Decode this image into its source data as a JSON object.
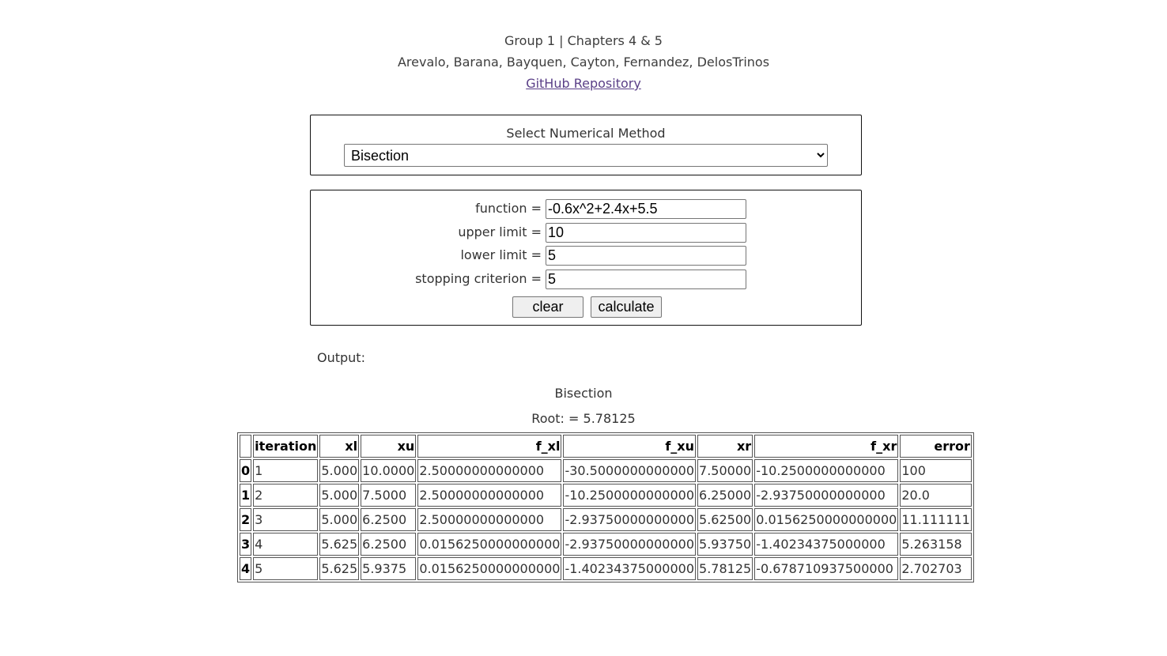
{
  "header": {
    "group_line": "Group 1 | Chapters 4 & 5",
    "authors": "Arevalo, Barana, Bayquen, Cayton, Fernandez, DelosTrinos",
    "repo_link": "GitHub Repository"
  },
  "method_panel": {
    "label": "Select Numerical Method",
    "selected": "Bisection"
  },
  "inputs": {
    "function_label": "function =",
    "function_value": "-0.6x^2+2.4x+5.5",
    "upper_label": "upper limit =",
    "upper_value": "10",
    "lower_label": "lower limit =",
    "lower_value": "5",
    "stop_label": "stopping criterion =",
    "stop_value": "5",
    "clear_label": "clear",
    "calculate_label": "calculate"
  },
  "output": {
    "label": "Output:",
    "method": "Bisection",
    "root": "Root: = 5.78125"
  },
  "table": {
    "headers": [
      "",
      "iteration",
      "xl",
      "xu",
      "f_xl",
      "f_xu",
      "xr",
      "f_xr",
      "error"
    ],
    "rows": [
      [
        "0",
        "1",
        "5.000",
        "10.0000",
        "2.50000000000000",
        "-30.5000000000000",
        "7.50000",
        "-10.2500000000000",
        "100"
      ],
      [
        "1",
        "2",
        "5.000",
        "7.5000",
        "2.50000000000000",
        "-10.2500000000000",
        "6.25000",
        "-2.93750000000000",
        "20.0"
      ],
      [
        "2",
        "3",
        "5.000",
        "6.2500",
        "2.50000000000000",
        "-2.93750000000000",
        "5.62500",
        "0.0156250000000000",
        "11.111111"
      ],
      [
        "3",
        "4",
        "5.625",
        "6.2500",
        "0.0156250000000000",
        "-2.93750000000000",
        "5.93750",
        "-1.40234375000000",
        "5.263158"
      ],
      [
        "4",
        "5",
        "5.625",
        "5.9375",
        "0.0156250000000000",
        "-1.40234375000000",
        "5.78125",
        "-0.678710937500000",
        "2.702703"
      ]
    ]
  }
}
